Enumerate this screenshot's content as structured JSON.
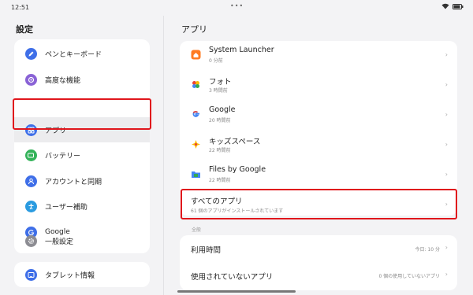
{
  "status_bar": {
    "time": "12:51",
    "dots": "•••"
  },
  "left": {
    "title": "設定",
    "items": [
      {
        "label": "ペンとキーボード",
        "icon": "pen-icon",
        "color": "#3f6fe8"
      },
      {
        "label": "高度な機能",
        "icon": "advanced-features-icon",
        "color": "#8a63d6"
      },
      {
        "label": "アプリ",
        "icon": "apps-grid-icon",
        "color": "#3f6fe8"
      },
      {
        "label": "バッテリー",
        "icon": "battery-icon",
        "color": "#34b35a"
      },
      {
        "label": "アカウントと同期",
        "icon": "account-icon",
        "color": "#3f6fe8"
      },
      {
        "label": "ユーザー補助",
        "icon": "accessibility-icon",
        "color": "#2a9be0"
      },
      {
        "label": "Google",
        "icon": "google-icon",
        "color": "#3f6fe8"
      },
      {
        "label": "一般設定",
        "icon": "gear-icon",
        "color": "#8d8d93"
      }
    ],
    "tablet_info": {
      "label": "タブレット情報",
      "icon": "tablet-icon",
      "color": "#3f6fe8"
    }
  },
  "right": {
    "title": "アプリ",
    "apps": [
      {
        "name": "System Launcher",
        "sub": "0 分前",
        "icon": "launcher-icon"
      },
      {
        "name": "フォト",
        "sub": "3 時間前",
        "icon": "photos-icon"
      },
      {
        "name": "Google",
        "sub": "20 時間前",
        "icon": "google-icon"
      },
      {
        "name": "キッズスペース",
        "sub": "22 時間前",
        "icon": "kids-space-icon"
      },
      {
        "name": "Files by Google",
        "sub": "22 時間前",
        "icon": "files-icon"
      }
    ],
    "all_apps": {
      "title": "すべてのアプリ",
      "sub": "61 個のアプリがインストールされています"
    },
    "section_label": "全般",
    "general": [
      {
        "title": "利用時間",
        "value": "今日: 10 分"
      },
      {
        "title": "使用されていないアプリ",
        "value": "0 個の使用していないアプリ"
      }
    ]
  },
  "colors": {
    "highlight": "#e0161c",
    "accent": "#3f6fe8"
  }
}
